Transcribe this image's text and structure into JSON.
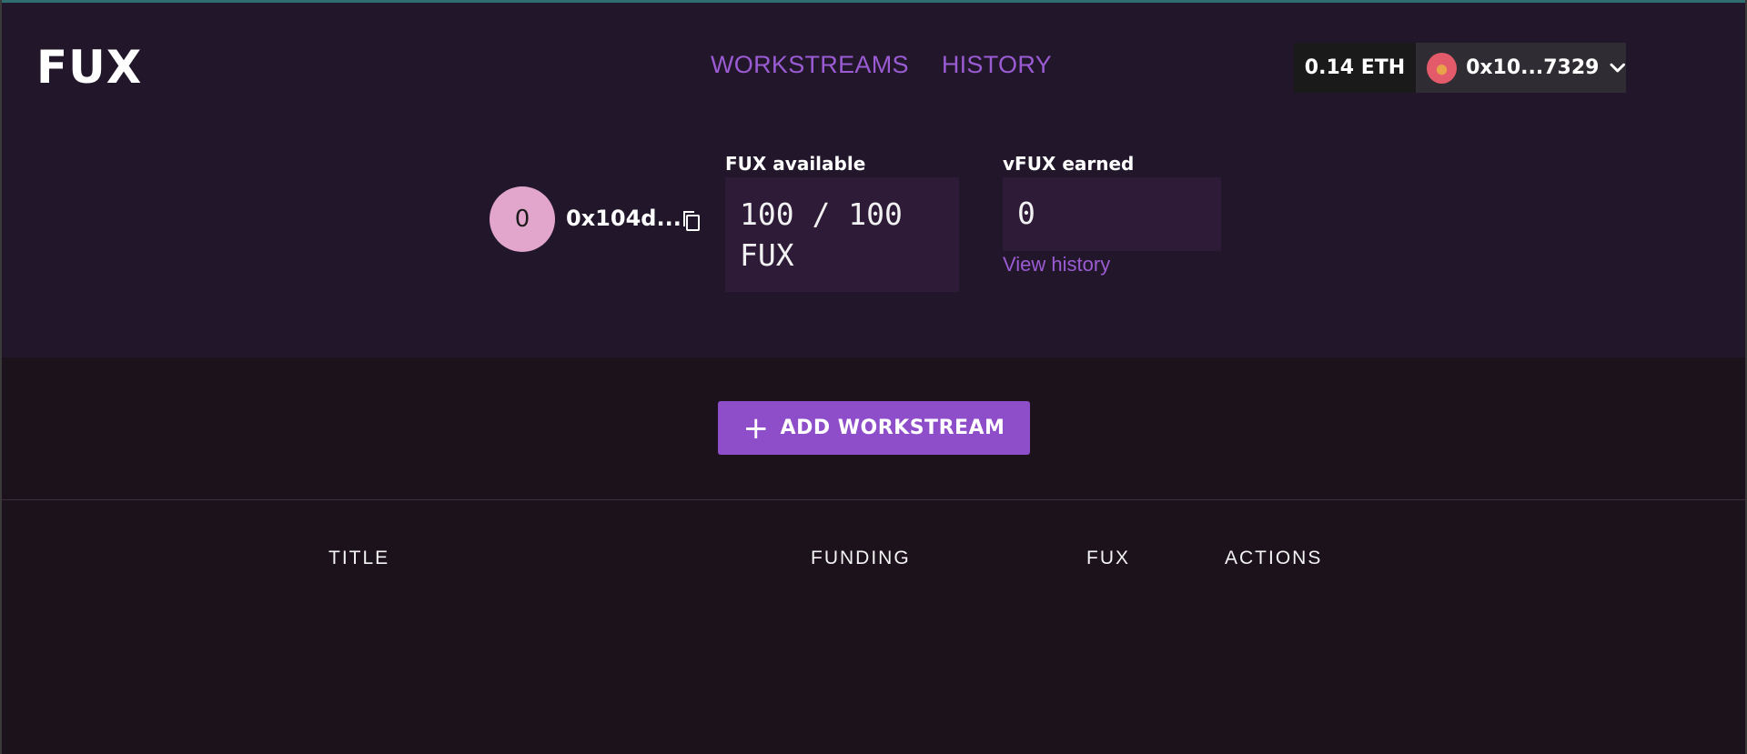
{
  "header": {
    "logo": "FUX",
    "nav": [
      {
        "label": "WORKSTREAMS"
      },
      {
        "label": "HISTORY"
      }
    ],
    "wallet": {
      "balance": "0.14 ETH",
      "account": "0x10...7329"
    }
  },
  "profile": {
    "avatar_initial": "0",
    "address": "0x104d..."
  },
  "stats": {
    "fux_available_label": "FUX available",
    "fux_available_value": "100 / 100",
    "fux_available_unit": "FUX",
    "vfux_earned_label": "vFUX earned",
    "vfux_earned_value": "0",
    "view_history": "View history"
  },
  "actions": {
    "add_workstream": "ADD WORKSTREAM"
  },
  "table": {
    "columns": [
      "TITLE",
      "FUNDING",
      "FUX",
      "ACTIONS"
    ]
  },
  "colors": {
    "accent": "#8e4dc9",
    "nav_link": "#9a5bd3",
    "hero_bg": "#22162a",
    "page_bg": "#1c121c"
  }
}
